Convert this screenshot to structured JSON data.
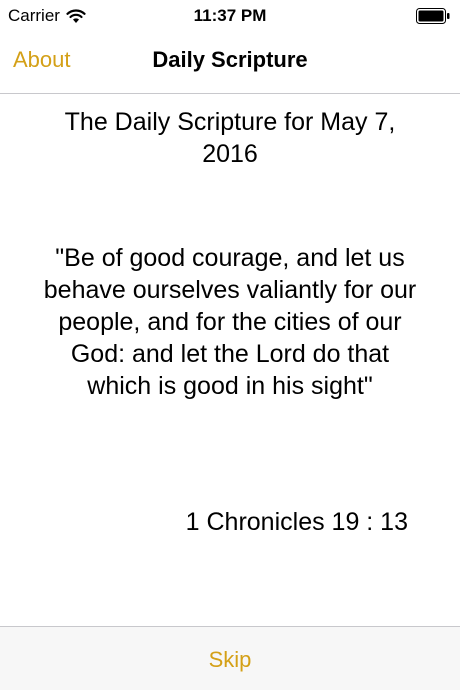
{
  "status_bar": {
    "carrier": "Carrier",
    "time": "11:37 PM",
    "wifi_icon": "wifi-icon",
    "battery_icon": "battery-icon"
  },
  "nav": {
    "left_button": "About",
    "title": "Daily Scripture"
  },
  "content": {
    "date_heading": "The Daily Scripture for May 7, 2016",
    "verse": "\"Be of good courage, and let us behave ourselves valiantly for our people, and for the cities of our God: and let the Lord do that which is good in his sight\"",
    "reference": "1 Chronicles 19 : 13"
  },
  "bottom_bar": {
    "skip_label": "Skip"
  },
  "colors": {
    "accent": "#d4a017",
    "separator": "#c8c8cc"
  }
}
